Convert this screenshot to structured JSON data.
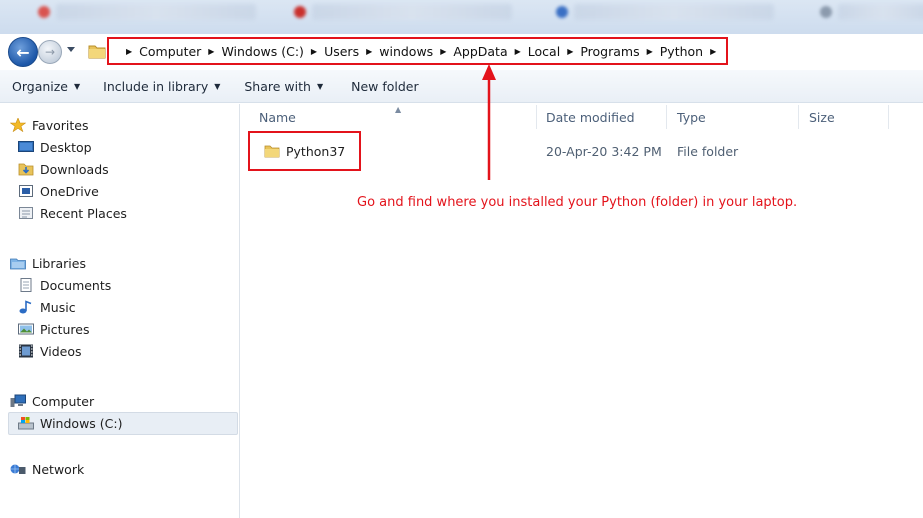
{
  "address_bar": {
    "crumbs": [
      "Computer",
      "Windows (C:)",
      "Users",
      "windows",
      "AppData",
      "Local",
      "Programs",
      "Python"
    ]
  },
  "toolbar": {
    "organize": "Organize",
    "include_in_library": "Include in library",
    "share_with": "Share with",
    "new_folder": "New folder"
  },
  "nav": {
    "favorites": "Favorites",
    "desktop": "Desktop",
    "downloads": "Downloads",
    "onedrive": "OneDrive",
    "recent_places": "Recent Places",
    "libraries": "Libraries",
    "documents": "Documents",
    "music": "Music",
    "pictures": "Pictures",
    "videos": "Videos",
    "computer": "Computer",
    "windows_c": "Windows (C:)",
    "network": "Network"
  },
  "columns": {
    "name": "Name",
    "date_modified": "Date modified",
    "type": "Type",
    "size": "Size"
  },
  "files": [
    {
      "name": "Python37",
      "date_modified": "20-Apr-20 3:42 PM",
      "type": "File folder",
      "size": ""
    }
  ],
  "annotation": "Go and find where you installed your Python (folder) in your laptop.",
  "colors": {
    "annotation_red": "#e3131b",
    "toolbar_bg": "#edf2f8",
    "selection_bg": "#e8eef5"
  }
}
